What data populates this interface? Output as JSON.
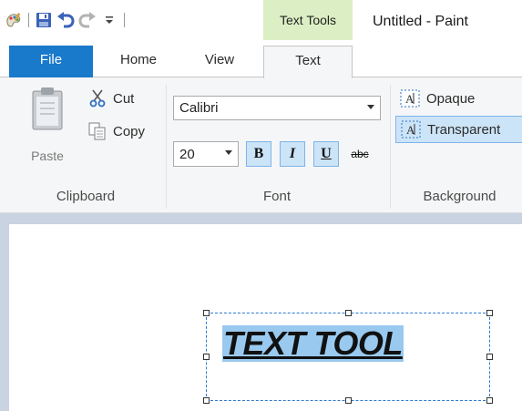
{
  "window": {
    "title": "Untitled - Paint"
  },
  "quick_access": [
    {
      "icon": "paint-app-icon"
    },
    {
      "icon": "save-icon"
    },
    {
      "icon": "undo-icon"
    },
    {
      "icon": "redo-icon"
    },
    {
      "icon": "customize-dropdown-icon"
    }
  ],
  "context_tab": {
    "header": "Text Tools"
  },
  "tabs": {
    "file": "File",
    "home": "Home",
    "view": "View",
    "text": "Text",
    "active": "Text"
  },
  "clipboard": {
    "paste": "Paste",
    "cut": "Cut",
    "copy": "Copy",
    "group_label": "Clipboard"
  },
  "font": {
    "family": "Calibri",
    "size": "20",
    "bold": "B",
    "italic": "I",
    "underline": "U",
    "strikethrough": "abc",
    "group_label": "Font"
  },
  "background": {
    "opaque": "Opaque",
    "transparent": "Transparent",
    "selected": "Transparent",
    "group_label": "Background"
  },
  "canvas": {
    "text": "TEXT TOOL"
  },
  "colors": {
    "file_tab": "#1979ca",
    "context_tab": "#dcefc4",
    "selection": "#99c9ef",
    "workspace": "#c9d3e1",
    "active_button": "#cce4f7"
  }
}
